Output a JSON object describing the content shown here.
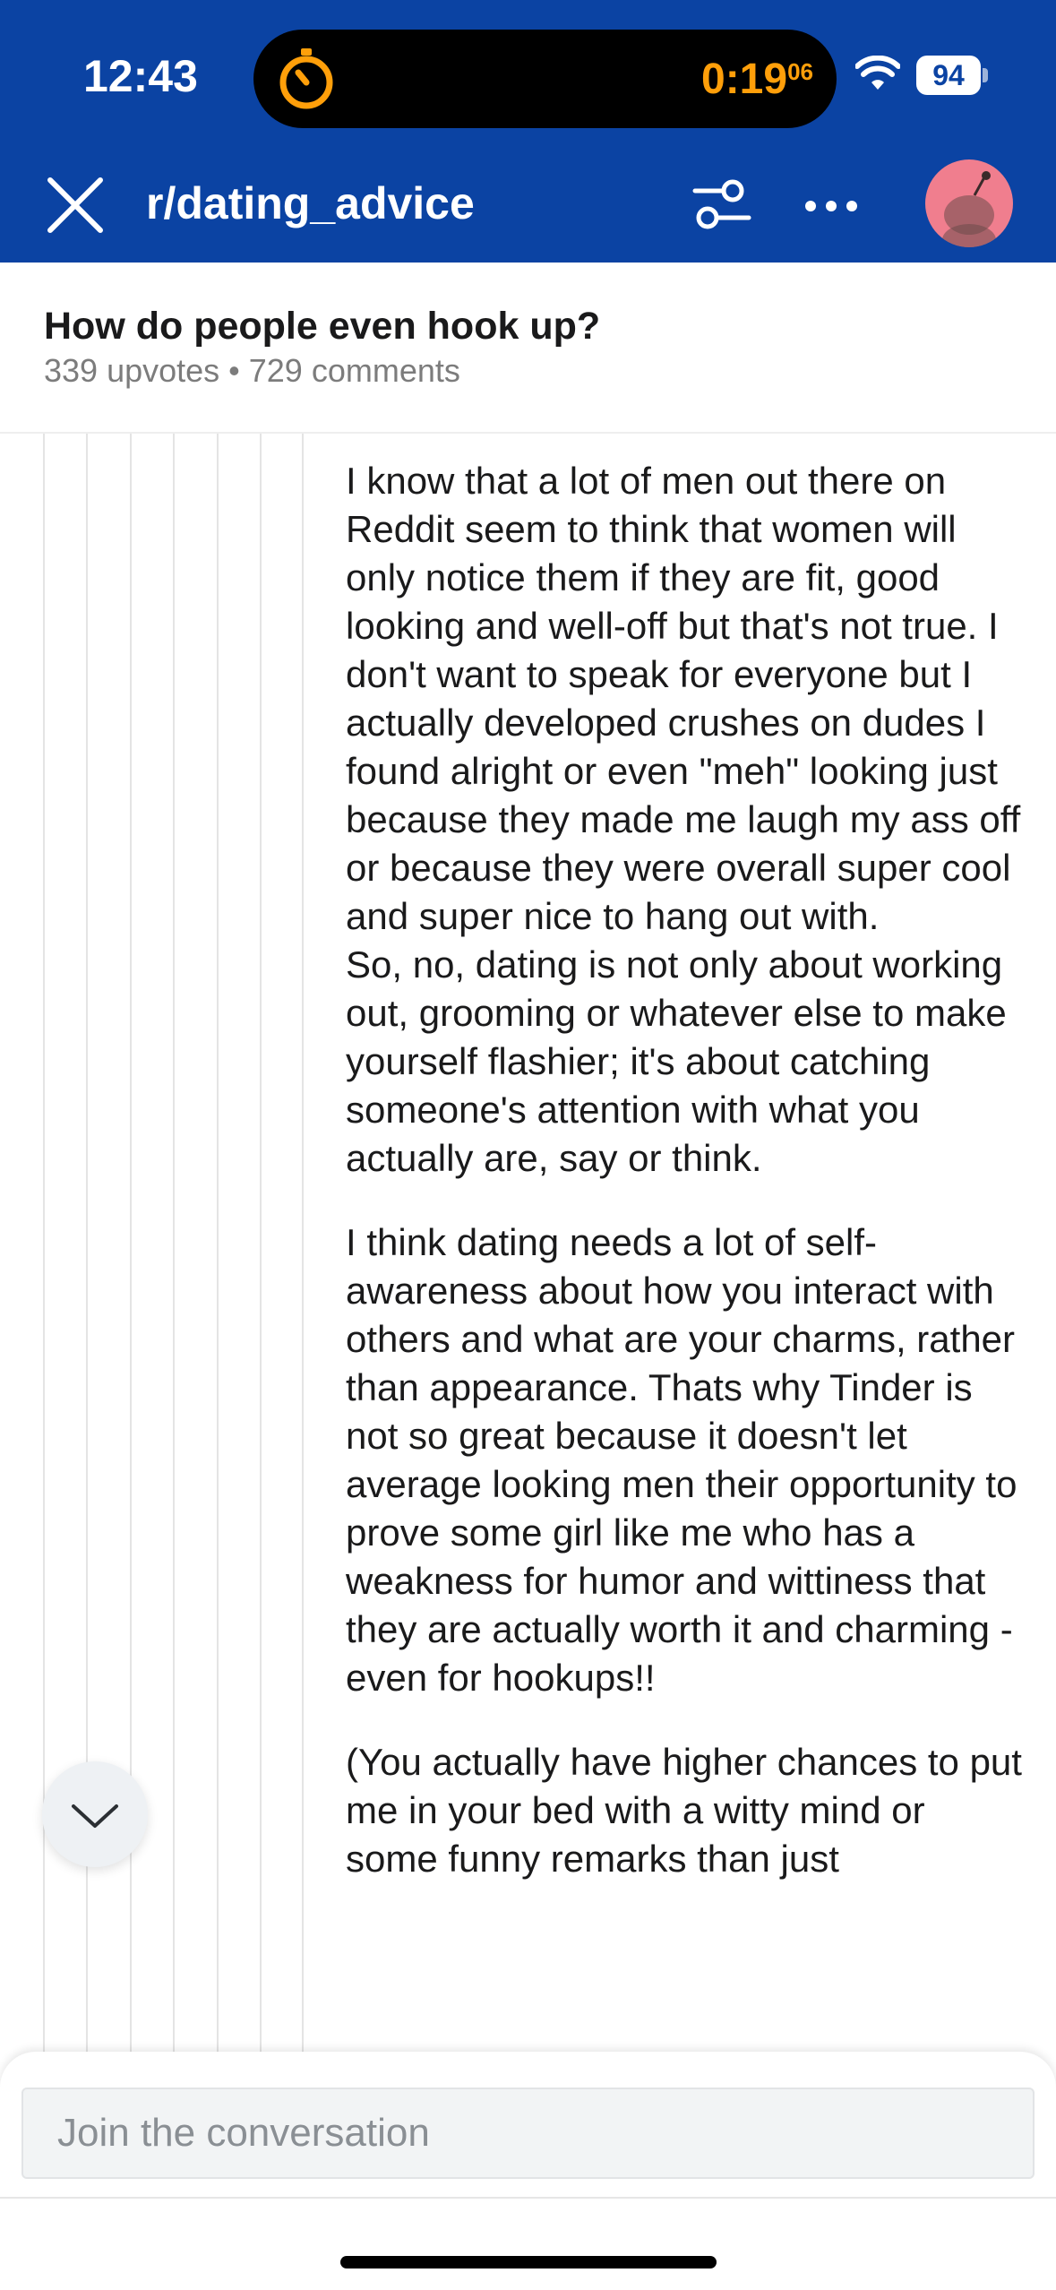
{
  "status_bar": {
    "time": "12:43",
    "timer_main": "0:19",
    "timer_sub": "06",
    "battery": "94"
  },
  "nav": {
    "subreddit": "r/dating_advice",
    "icons": [
      "close-icon",
      "filter-icon",
      "more-icon",
      "avatar"
    ]
  },
  "post": {
    "title": "How do people even hook up?",
    "meta": "339 upvotes • 729 comments"
  },
  "comment": {
    "paragraphs": [
      "I know that a lot of men out there on Reddit seem to think that women will only notice them if they are fit, good looking and well-off but that's not true. I don't want to speak for everyone but I actually developed crushes on dudes I found alright or even \"meh\" looking just because they made me laugh my ass off or because they were overall super cool and super nice to hang out with.\nSo, no, dating is not only about working out, grooming or whatever else to make yourself flashier; it's about catching someone's attention with what you actually are, say or think.",
      "I think dating needs a lot of self-awareness about how you interact with others and what are your charms, rather than appearance. Thats why Tinder is not so great because it doesn't let average looking men their opportunity to prove some girl like me who has a weakness for humor and wittiness that they are actually worth it and charming - even for hookups!!",
      "(You actually have higher chances to put me in your bed with a witty mind or some funny remarks than just"
    ]
  },
  "composer": {
    "placeholder": "Join the conversation"
  },
  "colors": {
    "header_bg": "#0b43a3",
    "timer_orange": "#ff9f0a",
    "avatar_pink": "#f07e8e"
  }
}
